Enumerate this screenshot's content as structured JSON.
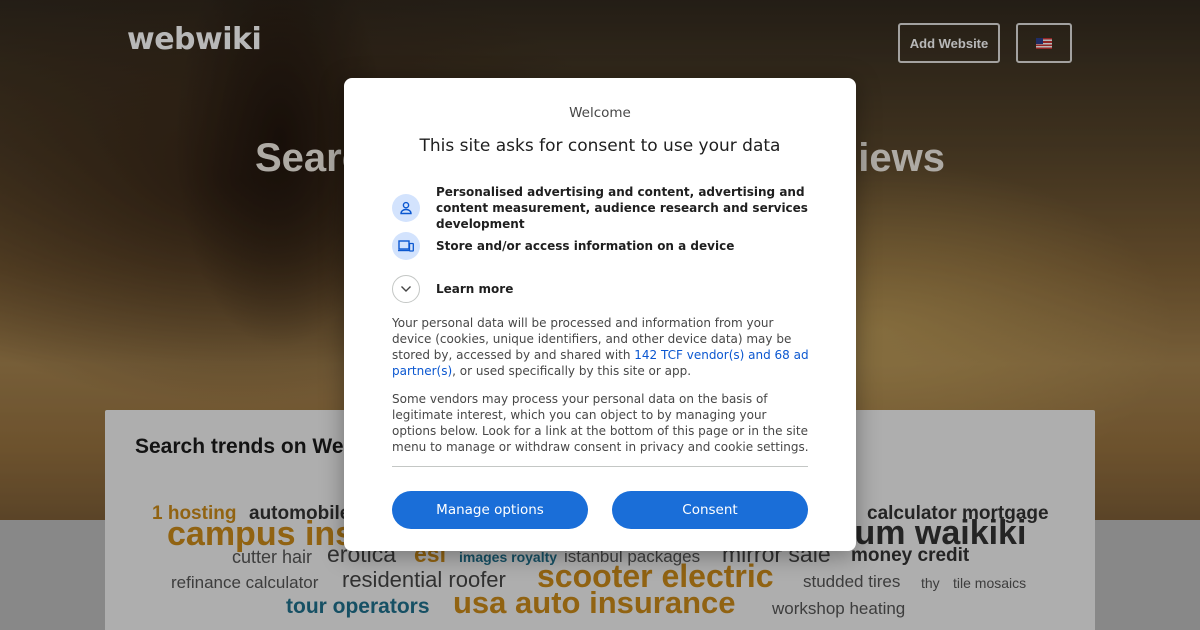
{
  "site": {
    "logo": "webwiki",
    "add_website_label": "Add Website",
    "language_icon": "us-flag-icon",
    "hero_title_left": "Searc",
    "hero_title_right": "iews"
  },
  "trends": {
    "title": "Search trends on Web",
    "tags": [
      {
        "text": "1 hosting",
        "color": "#c98a1a",
        "size": 19,
        "bold": true
      },
      {
        "text": "automobile",
        "color": "#333333",
        "size": 19,
        "bold": true
      },
      {
        "text": "campus ins",
        "color": "#c98a1a",
        "size": 34,
        "bold": true
      },
      {
        "text": "cutter hair",
        "color": "#555555",
        "size": 18,
        "bold": false
      },
      {
        "text": "erotica",
        "color": "#444444",
        "size": 23,
        "bold": false
      },
      {
        "text": "esl",
        "color": "#c98a1a",
        "size": 23,
        "bold": true
      },
      {
        "text": "images royalty",
        "color": "#1f6f8b",
        "size": 14,
        "bold": true
      },
      {
        "text": "istanbul packages",
        "color": "#555555",
        "size": 17,
        "bold": false
      },
      {
        "text": "mirror sale",
        "color": "#444444",
        "size": 23,
        "bold": false
      },
      {
        "text": "money credit",
        "color": "#333333",
        "size": 19,
        "bold": true
      },
      {
        "text": "calculator mortgage",
        "color": "#333333",
        "size": 19,
        "bold": true
      },
      {
        "text": "ium waikiki",
        "color": "#333333",
        "size": 34,
        "bold": true
      },
      {
        "text": "refinance calculator",
        "color": "#555555",
        "size": 17,
        "bold": false
      },
      {
        "text": "residential roofer",
        "color": "#444444",
        "size": 22,
        "bold": false
      },
      {
        "text": "scooter electric",
        "color": "#c98a1a",
        "size": 32,
        "bold": true
      },
      {
        "text": "studded tires",
        "color": "#555555",
        "size": 17,
        "bold": false
      },
      {
        "text": "thy",
        "color": "#555555",
        "size": 14,
        "bold": false
      },
      {
        "text": "tile mosaics",
        "color": "#555555",
        "size": 14,
        "bold": false
      },
      {
        "text": "tour operators",
        "color": "#1f6f8b",
        "size": 21,
        "bold": true
      },
      {
        "text": "usa auto insurance",
        "color": "#c98a1a",
        "size": 31,
        "bold": true
      },
      {
        "text": "workshop heating",
        "color": "#555555",
        "size": 17,
        "bold": false
      }
    ]
  },
  "consent": {
    "welcome": "Welcome",
    "title": "This site asks for consent to use your data",
    "purposes": [
      {
        "icon": "person-icon",
        "text": "Personalised advertising and content, advertising and content measurement, audience research and services development"
      },
      {
        "icon": "devices-icon",
        "text": "Store and/or access information on a device"
      },
      {
        "icon": "chevron-down-icon",
        "text": "Learn more"
      }
    ],
    "paragraph1_before": "Your personal data will be processed and information from your device (cookies, unique identifiers, and other device data) may be stored by, accessed by and shared with ",
    "paragraph1_link": "142 TCF vendor(s) and 68 ad partner(s)",
    "paragraph1_after": ", or used specifically by this site or app.",
    "paragraph2": "Some vendors may process your personal data on the basis of legitimate interest, which you can object to by managing your options below. Look for a link at the bottom of this page or in the site menu to manage or withdraw consent in privacy and cookie settings.",
    "manage_label": "Manage options",
    "consent_label": "Consent",
    "accent_color": "#1a6ed8"
  }
}
